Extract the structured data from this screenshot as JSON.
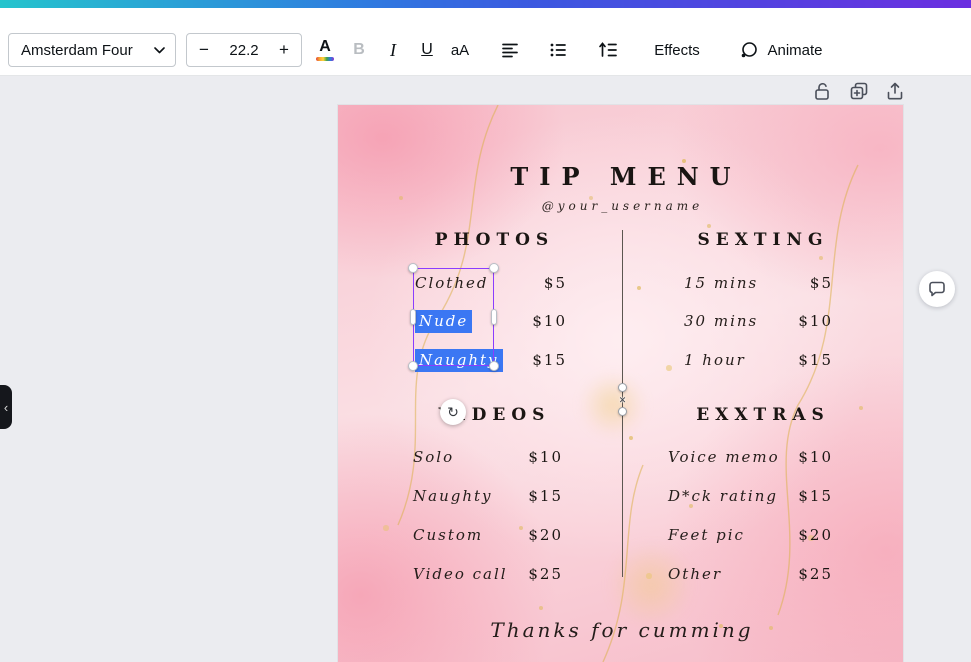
{
  "toolbar": {
    "font_name": "Amsterdam Four",
    "font_size": "22.2",
    "minus_label": "−",
    "plus_label": "+",
    "color_label": "A",
    "bold_label": "B",
    "italic_label": "I",
    "underline_label": "U",
    "case_label": "aA",
    "effects_label": "Effects",
    "animate_label": "Animate"
  },
  "icons": {
    "rotate_glyph": "↻",
    "panel_collapse_glyph": "‹",
    "line_handle_cross": "✕"
  },
  "colors": {
    "selection_border": "#8b3dff",
    "text_highlight": "#3b77f3",
    "brand_gradient_left": "#25c4cd",
    "brand_gradient_mid": "#3b58e0",
    "brand_gradient_right": "#6b2ee0",
    "page_background": "#f8c6d0",
    "gold_accent": "#e0ba60"
  },
  "design": {
    "title": "TIP MENU",
    "username": "@your_username",
    "footer": "Thanks for cumming",
    "photos": {
      "heading": "PHOTOS",
      "items": [
        {
          "label": "Clothed",
          "price": "$5"
        },
        {
          "label": "Nude",
          "price": "$10"
        },
        {
          "label": "Naughty",
          "price": "$15"
        }
      ]
    },
    "sexting": {
      "heading": "SEXTING",
      "items": [
        {
          "label": "15 mins",
          "price": "$5"
        },
        {
          "label": "30 mins",
          "price": "$10"
        },
        {
          "label": "1 hour",
          "price": "$15"
        }
      ]
    },
    "videos": {
      "heading": "VIDEOS",
      "items": [
        {
          "label": "Solo",
          "price": "$10"
        },
        {
          "label": "Naughty",
          "price": "$15"
        },
        {
          "label": "Custom",
          "price": "$20"
        },
        {
          "label": "Video call",
          "price": "$25"
        }
      ]
    },
    "exxtras": {
      "heading": "EXXTRAS",
      "items": [
        {
          "label": "Voice memo",
          "price": "$10"
        },
        {
          "label": "D*ck rating",
          "price": "$15"
        },
        {
          "label": "Feet pic",
          "price": "$20"
        },
        {
          "label": "Other",
          "price": "$25"
        }
      ]
    }
  }
}
